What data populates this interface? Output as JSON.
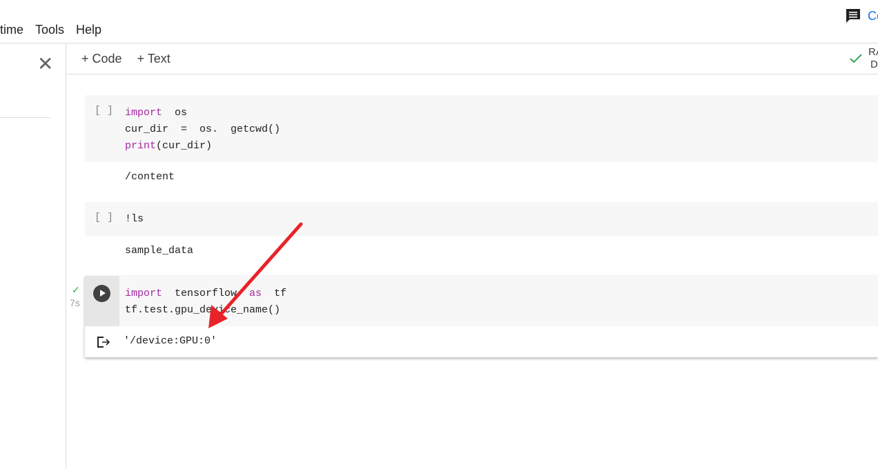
{
  "menu": {
    "items": [
      "time",
      "Tools",
      "Help"
    ]
  },
  "header": {
    "comment_label": "Co"
  },
  "toolbar": {
    "add_code": "+ Code",
    "add_text": "+ Text"
  },
  "status": {
    "ram_label": "RA",
    "disk_label": "Di",
    "connected_color": "#34a853"
  },
  "cells": [
    {
      "bracket": "[ ]",
      "lines": [
        [
          "import",
          "  os"
        ],
        [
          "",
          "cur_dir  =  os.  getcwd()"
        ],
        [
          "print",
          "(cur_dir)"
        ]
      ],
      "output": "/content"
    },
    {
      "bracket": "[ ]",
      "lines": [
        [
          "",
          "!ls"
        ]
      ],
      "output": "sample_data"
    },
    {
      "status": "✓",
      "exec_time": "7s",
      "lines": [
        [
          "import",
          "  tensorflow  ",
          "as",
          "  tf"
        ],
        [
          "",
          "tf.test.gpu_device_name()"
        ]
      ],
      "output": "'/device:GPU:0'"
    }
  ],
  "annotation": {
    "arrow_color": "#e8232a"
  }
}
